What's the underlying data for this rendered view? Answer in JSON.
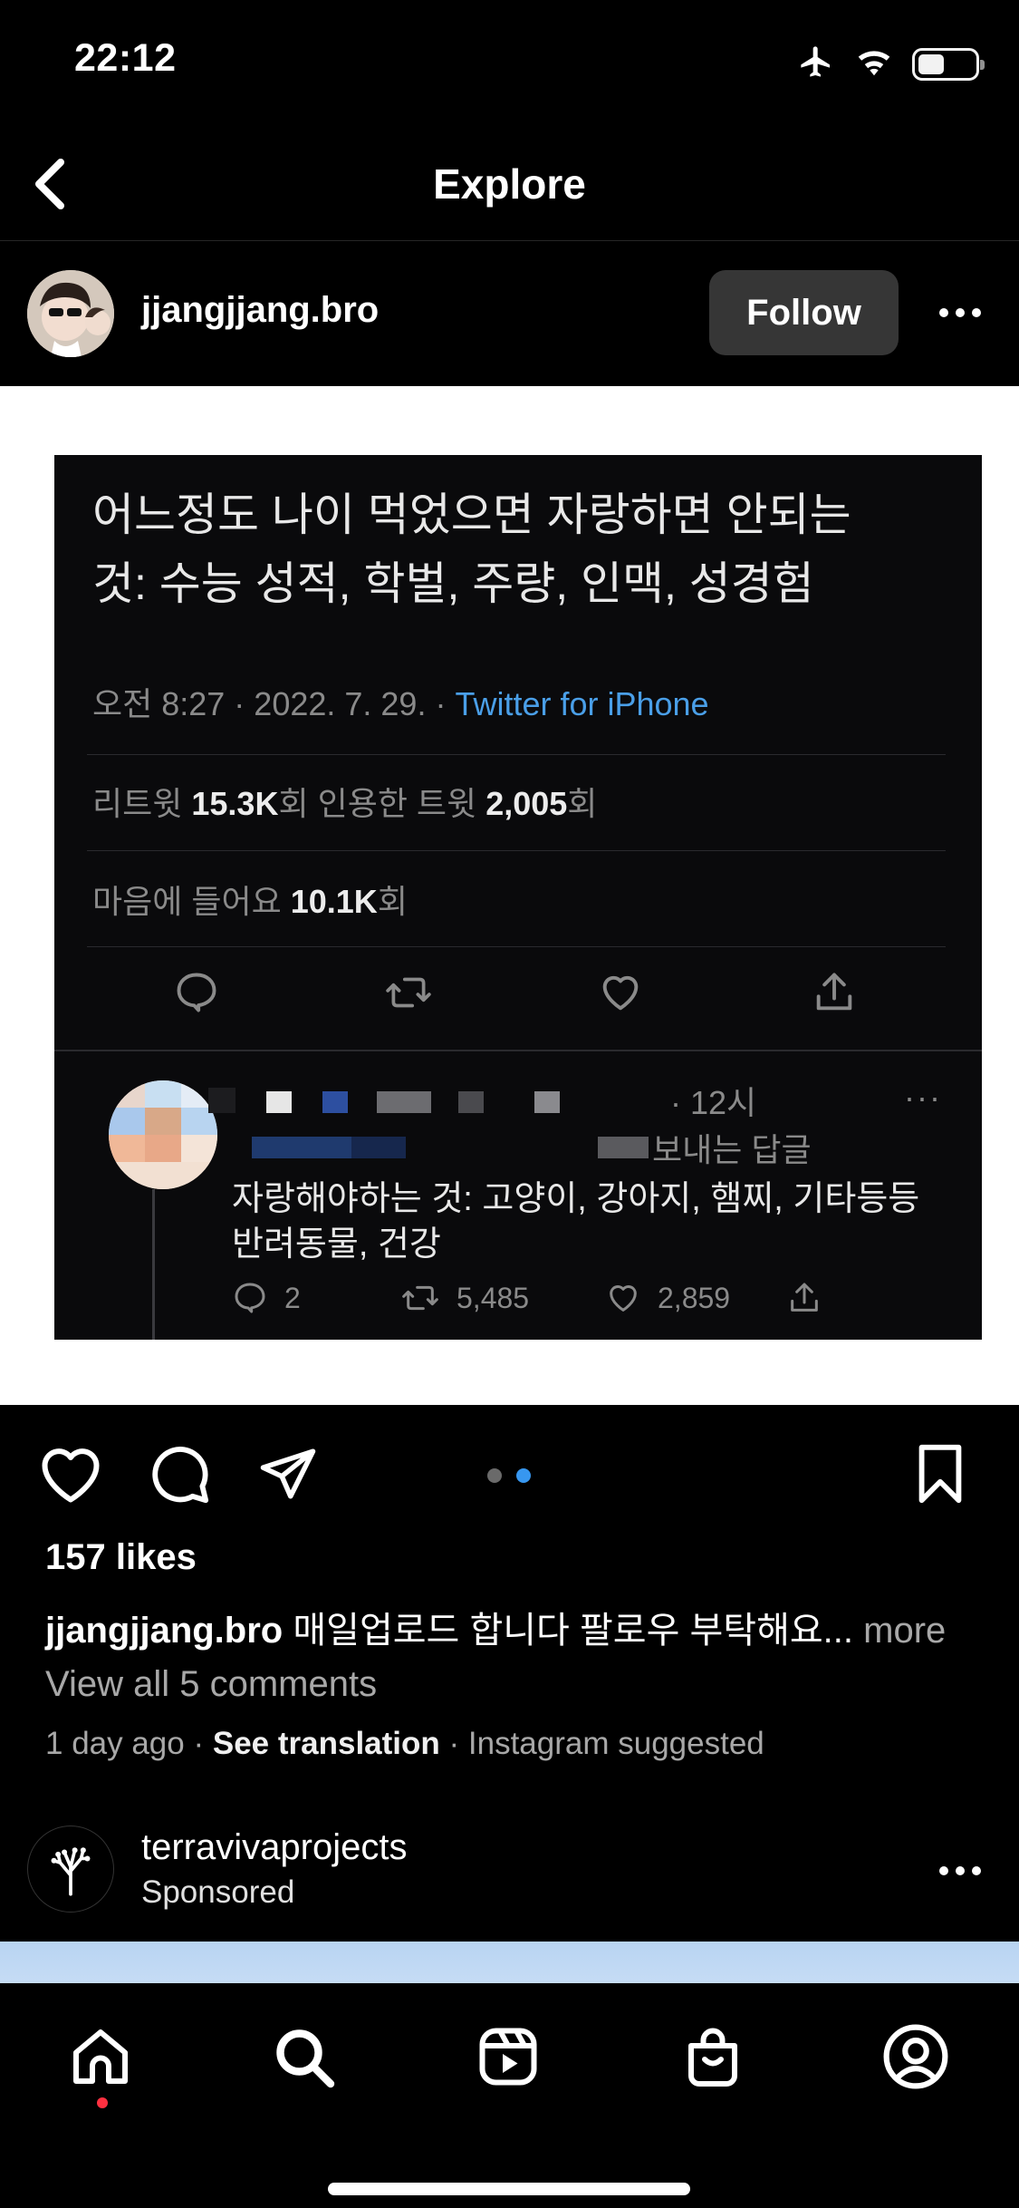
{
  "status_bar": {
    "time": "22:12",
    "battery_level": 0.45
  },
  "header": {
    "title": "Explore"
  },
  "post": {
    "username": "jjangjjang.bro",
    "follow_label": "Follow",
    "tweet": {
      "text_line1": "어느정도 나이 먹었으면 자랑하면 안되는",
      "text_line2": "것: 수능 성적, 학벌, 주량, 인맥, 성경험",
      "time": "오전 8:27 · 2022. 7. 29. · ",
      "source": "Twitter for iPhone",
      "retweets_label": "리트윗 ",
      "retweets_value": "15.3K",
      "retweets_unit": "회  인용한 트윗 ",
      "quotes_value": "2,005",
      "quotes_unit": "회",
      "likes_label": "마음에 들어요 ",
      "likes_value": "10.1K",
      "likes_unit": "회",
      "reply": {
        "time_partial": "· 12시",
        "sub_partial": "보내는 답글",
        "text_line1": "자랑해야하는 것: 고양이, 강아지, 햄찌, 기타등등",
        "text_line2": "반려동물, 건강",
        "comments": "2",
        "retweets": "5,485",
        "likes": "2,859"
      }
    },
    "carousel": {
      "count": 2,
      "active_index": 1
    },
    "likes_text": "157 likes",
    "caption_user": "jjangjjang.bro",
    "caption_text": " 매일업로드 합니다 팔로우 부탁해요...",
    "caption_more": " more",
    "view_comments": "View all 5 comments",
    "time_ago": "1 day ago",
    "sep": " · ",
    "see_translation": "See translation",
    "suggested": "Instagram suggested"
  },
  "sponsored": {
    "username": "terravivaprojects",
    "label": "Sponsored"
  },
  "icons": {
    "back": "chevron-left-icon",
    "more": "more-horizontal-icon",
    "like": "heart-icon",
    "comment": "comment-icon",
    "share": "paper-plane-icon",
    "save": "bookmark-icon",
    "tabs": [
      "home-icon",
      "search-icon",
      "reels-icon",
      "shop-icon",
      "profile-icon"
    ]
  },
  "colors": {
    "background": "#000000",
    "follow_button": "#363636",
    "carousel_active": "#3797f0",
    "twitter_link": "#4a9fe8",
    "notification_dot": "#ff3040"
  }
}
